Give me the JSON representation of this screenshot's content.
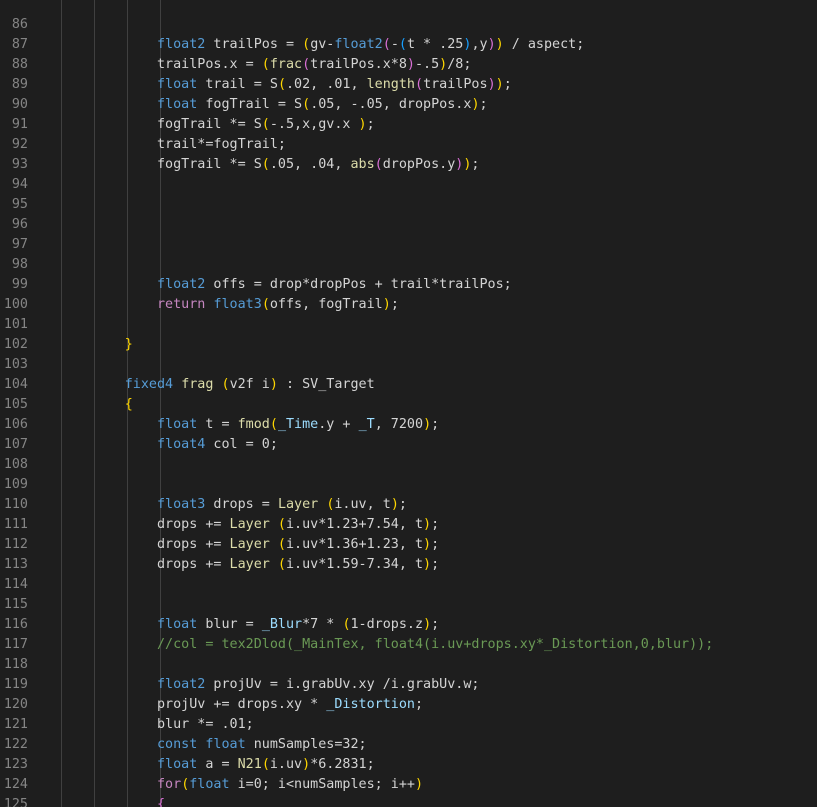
{
  "editor": {
    "lines": [
      {
        "n": "",
        "t": [
          {
            "c": "pl",
            "s": "                              "
          },
          {
            "c": "num",
            "s": ""
          }
        ]
      },
      {
        "n": "86",
        "t": []
      },
      {
        "n": "87",
        "t": [
          {
            "c": "pl",
            "s": "                "
          },
          {
            "c": "kw",
            "s": "float2"
          },
          {
            "c": "pl",
            "s": " trailPos = "
          },
          {
            "c": "p1",
            "s": "("
          },
          {
            "c": "pl",
            "s": "gv-"
          },
          {
            "c": "kw",
            "s": "float2"
          },
          {
            "c": "p2",
            "s": "("
          },
          {
            "c": "pl",
            "s": "-"
          },
          {
            "c": "p3",
            "s": "("
          },
          {
            "c": "pl",
            "s": "t * .25"
          },
          {
            "c": "p3",
            "s": ")"
          },
          {
            "c": "pl",
            "s": ",y"
          },
          {
            "c": "p2",
            "s": ")"
          },
          {
            "c": "p1",
            "s": ")"
          },
          {
            "c": "pl",
            "s": " / aspect;"
          }
        ]
      },
      {
        "n": "88",
        "t": [
          {
            "c": "pl",
            "s": "                trailPos.x = "
          },
          {
            "c": "p1",
            "s": "("
          },
          {
            "c": "fn",
            "s": "frac"
          },
          {
            "c": "p2",
            "s": "("
          },
          {
            "c": "pl",
            "s": "trailPos.x*8"
          },
          {
            "c": "p2",
            "s": ")"
          },
          {
            "c": "pl",
            "s": "-.5"
          },
          {
            "c": "p1",
            "s": ")"
          },
          {
            "c": "pl",
            "s": "/8;"
          }
        ]
      },
      {
        "n": "89",
        "t": [
          {
            "c": "pl",
            "s": "                "
          },
          {
            "c": "kw",
            "s": "float"
          },
          {
            "c": "pl",
            "s": " trail = S"
          },
          {
            "c": "p1",
            "s": "("
          },
          {
            "c": "pl",
            "s": ".02, .01, "
          },
          {
            "c": "fn",
            "s": "length"
          },
          {
            "c": "p2",
            "s": "("
          },
          {
            "c": "pl",
            "s": "trailPos"
          },
          {
            "c": "p2",
            "s": ")"
          },
          {
            "c": "p1",
            "s": ")"
          },
          {
            "c": "pl",
            "s": ";"
          }
        ]
      },
      {
        "n": "90",
        "t": [
          {
            "c": "pl",
            "s": "                "
          },
          {
            "c": "kw",
            "s": "float"
          },
          {
            "c": "pl",
            "s": " fogTrail = S"
          },
          {
            "c": "p1",
            "s": "("
          },
          {
            "c": "pl",
            "s": ".05, -.05, dropPos.x"
          },
          {
            "c": "p1",
            "s": ")"
          },
          {
            "c": "pl",
            "s": ";"
          }
        ]
      },
      {
        "n": "91",
        "t": [
          {
            "c": "pl",
            "s": "                fogTrail *= S"
          },
          {
            "c": "p1",
            "s": "("
          },
          {
            "c": "pl",
            "s": "-.5,x,gv.x "
          },
          {
            "c": "p1",
            "s": ")"
          },
          {
            "c": "pl",
            "s": ";"
          }
        ]
      },
      {
        "n": "92",
        "t": [
          {
            "c": "pl",
            "s": "                trail*=fogTrail;"
          }
        ]
      },
      {
        "n": "93",
        "t": [
          {
            "c": "pl",
            "s": "                fogTrail *= S"
          },
          {
            "c": "p1",
            "s": "("
          },
          {
            "c": "pl",
            "s": ".05, .04, "
          },
          {
            "c": "fn",
            "s": "abs"
          },
          {
            "c": "p2",
            "s": "("
          },
          {
            "c": "pl",
            "s": "dropPos.y"
          },
          {
            "c": "p2",
            "s": ")"
          },
          {
            "c": "p1",
            "s": ")"
          },
          {
            "c": "pl",
            "s": ";"
          }
        ]
      },
      {
        "n": "94",
        "t": []
      },
      {
        "n": "95",
        "t": []
      },
      {
        "n": "96",
        "t": []
      },
      {
        "n": "97",
        "t": []
      },
      {
        "n": "98",
        "t": []
      },
      {
        "n": "99",
        "t": [
          {
            "c": "pl",
            "s": "                "
          },
          {
            "c": "kw",
            "s": "float2"
          },
          {
            "c": "pl",
            "s": " offs = drop*dropPos + trail*trailPos;"
          }
        ]
      },
      {
        "n": "100",
        "t": [
          {
            "c": "pl",
            "s": "                "
          },
          {
            "c": "ctl",
            "s": "return"
          },
          {
            "c": "pl",
            "s": " "
          },
          {
            "c": "kw",
            "s": "float3"
          },
          {
            "c": "p1",
            "s": "("
          },
          {
            "c": "pl",
            "s": "offs, fogTrail"
          },
          {
            "c": "p1",
            "s": ")"
          },
          {
            "c": "pl",
            "s": ";"
          }
        ]
      },
      {
        "n": "101",
        "t": []
      },
      {
        "n": "102",
        "t": [
          {
            "c": "pl",
            "s": "            "
          },
          {
            "c": "p1",
            "s": "}"
          }
        ]
      },
      {
        "n": "103",
        "t": []
      },
      {
        "n": "104",
        "t": [
          {
            "c": "pl",
            "s": "            "
          },
          {
            "c": "kw",
            "s": "fixed4"
          },
          {
            "c": "pl",
            "s": " "
          },
          {
            "c": "fn",
            "s": "frag"
          },
          {
            "c": "pl",
            "s": " "
          },
          {
            "c": "p1",
            "s": "("
          },
          {
            "c": "pl",
            "s": "v2f i"
          },
          {
            "c": "p1",
            "s": ")"
          },
          {
            "c": "pl",
            "s": " : SV_Target"
          }
        ]
      },
      {
        "n": "105",
        "t": [
          {
            "c": "pl",
            "s": "            "
          },
          {
            "c": "p1",
            "s": "{"
          }
        ]
      },
      {
        "n": "106",
        "t": [
          {
            "c": "pl",
            "s": "                "
          },
          {
            "c": "kw",
            "s": "float"
          },
          {
            "c": "pl",
            "s": " t = "
          },
          {
            "c": "fn",
            "s": "fmod"
          },
          {
            "c": "p1",
            "s": "("
          },
          {
            "c": "id",
            "s": "_Time"
          },
          {
            "c": "pl",
            "s": ".y + "
          },
          {
            "c": "id",
            "s": "_T"
          },
          {
            "c": "pl",
            "s": ", 7200"
          },
          {
            "c": "p1",
            "s": ")"
          },
          {
            "c": "pl",
            "s": ";"
          }
        ]
      },
      {
        "n": "107",
        "t": [
          {
            "c": "pl",
            "s": "                "
          },
          {
            "c": "kw",
            "s": "float4"
          },
          {
            "c": "pl",
            "s": " col = 0;"
          }
        ]
      },
      {
        "n": "108",
        "t": []
      },
      {
        "n": "109",
        "t": []
      },
      {
        "n": "110",
        "t": [
          {
            "c": "pl",
            "s": "                "
          },
          {
            "c": "kw",
            "s": "float3"
          },
          {
            "c": "pl",
            "s": " drops = "
          },
          {
            "c": "fn",
            "s": "Layer"
          },
          {
            "c": "pl",
            "s": " "
          },
          {
            "c": "p1",
            "s": "("
          },
          {
            "c": "pl",
            "s": "i.uv, t"
          },
          {
            "c": "p1",
            "s": ")"
          },
          {
            "c": "pl",
            "s": ";"
          }
        ]
      },
      {
        "n": "111",
        "t": [
          {
            "c": "pl",
            "s": "                drops += "
          },
          {
            "c": "fn",
            "s": "Layer"
          },
          {
            "c": "pl",
            "s": " "
          },
          {
            "c": "p1",
            "s": "("
          },
          {
            "c": "pl",
            "s": "i.uv*1.23+7.54, t"
          },
          {
            "c": "p1",
            "s": ")"
          },
          {
            "c": "pl",
            "s": ";"
          }
        ]
      },
      {
        "n": "112",
        "t": [
          {
            "c": "pl",
            "s": "                drops += "
          },
          {
            "c": "fn",
            "s": "Layer"
          },
          {
            "c": "pl",
            "s": " "
          },
          {
            "c": "p1",
            "s": "("
          },
          {
            "c": "pl",
            "s": "i.uv*1.36+1.23, t"
          },
          {
            "c": "p1",
            "s": ")"
          },
          {
            "c": "pl",
            "s": ";"
          }
        ]
      },
      {
        "n": "113",
        "t": [
          {
            "c": "pl",
            "s": "                drops += "
          },
          {
            "c": "fn",
            "s": "Layer"
          },
          {
            "c": "pl",
            "s": " "
          },
          {
            "c": "p1",
            "s": "("
          },
          {
            "c": "pl",
            "s": "i.uv*1.59-7.34, t"
          },
          {
            "c": "p1",
            "s": ")"
          },
          {
            "c": "pl",
            "s": ";"
          }
        ]
      },
      {
        "n": "114",
        "t": []
      },
      {
        "n": "115",
        "t": []
      },
      {
        "n": "116",
        "t": [
          {
            "c": "pl",
            "s": "                "
          },
          {
            "c": "kw",
            "s": "float"
          },
          {
            "c": "pl",
            "s": " blur = "
          },
          {
            "c": "id",
            "s": "_Blur"
          },
          {
            "c": "pl",
            "s": "*7 * "
          },
          {
            "c": "p1",
            "s": "("
          },
          {
            "c": "pl",
            "s": "1-drops.z"
          },
          {
            "c": "p1",
            "s": ")"
          },
          {
            "c": "pl",
            "s": ";"
          }
        ]
      },
      {
        "n": "117",
        "t": [
          {
            "c": "pl",
            "s": "                "
          },
          {
            "c": "cm",
            "s": "//col = tex2Dlod(_MainTex, float4(i.uv+drops.xy*_Distortion,0,blur));"
          }
        ]
      },
      {
        "n": "118",
        "t": []
      },
      {
        "n": "119",
        "t": [
          {
            "c": "pl",
            "s": "                "
          },
          {
            "c": "kw",
            "s": "float2"
          },
          {
            "c": "pl",
            "s": " projUv = i.grabUv.xy /i.grabUv.w;"
          }
        ]
      },
      {
        "n": "120",
        "t": [
          {
            "c": "pl",
            "s": "                projUv += drops.xy * "
          },
          {
            "c": "id",
            "s": "_Distortion"
          },
          {
            "c": "pl",
            "s": ";"
          }
        ]
      },
      {
        "n": "121",
        "t": [
          {
            "c": "pl",
            "s": "                blur *= .01;"
          }
        ]
      },
      {
        "n": "122",
        "t": [
          {
            "c": "pl",
            "s": "                "
          },
          {
            "c": "kw",
            "s": "const"
          },
          {
            "c": "pl",
            "s": " "
          },
          {
            "c": "kw",
            "s": "float"
          },
          {
            "c": "pl",
            "s": " numSamples=32;"
          }
        ]
      },
      {
        "n": "123",
        "t": [
          {
            "c": "pl",
            "s": "                "
          },
          {
            "c": "kw",
            "s": "float"
          },
          {
            "c": "pl",
            "s": " a = "
          },
          {
            "c": "fn",
            "s": "N21"
          },
          {
            "c": "p1",
            "s": "("
          },
          {
            "c": "pl",
            "s": "i.uv"
          },
          {
            "c": "p1",
            "s": ")"
          },
          {
            "c": "pl",
            "s": "*6.2831;"
          }
        ]
      },
      {
        "n": "124",
        "t": [
          {
            "c": "pl",
            "s": "                "
          },
          {
            "c": "ctl",
            "s": "for"
          },
          {
            "c": "p1",
            "s": "("
          },
          {
            "c": "kw",
            "s": "float"
          },
          {
            "c": "pl",
            "s": " i=0; i<numSamples; i++"
          },
          {
            "c": "p1",
            "s": ")"
          }
        ]
      },
      {
        "n": "125",
        "t": [
          {
            "c": "pl",
            "s": "                "
          },
          {
            "c": "p2",
            "s": "{"
          }
        ]
      }
    ]
  }
}
